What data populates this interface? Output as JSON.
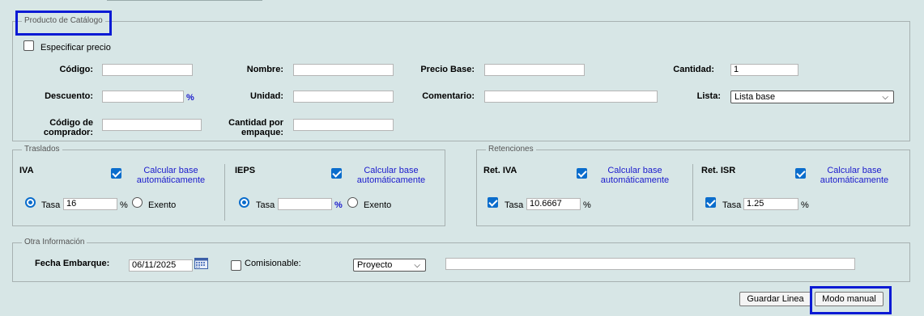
{
  "catalog": {
    "legend": "Producto de Catálogo",
    "especificar_precio": "Especificar precio",
    "codigo_label": "Código:",
    "codigo_value": "",
    "nombre_label": "Nombre:",
    "nombre_value": "",
    "precio_base_label": "Precio Base:",
    "precio_base_value": "",
    "cantidad_label": "Cantidad:",
    "cantidad_value": "1",
    "descuento_label": "Descuento:",
    "descuento_value": "",
    "percent": "%",
    "unidad_label": "Unidad:",
    "unidad_value": "",
    "comentario_label": "Comentario:",
    "comentario_value": "",
    "lista_label": "Lista:",
    "lista_value": "Lista base",
    "codigo_comprador_label_1": "Código de",
    "codigo_comprador_label_2": "comprador:",
    "codigo_comprador_value": "",
    "cantidad_empaque_label_1": "Cantidad por",
    "cantidad_empaque_label_2": "empaque:",
    "cantidad_empaque_value": ""
  },
  "traslados": {
    "legend": "Traslados",
    "iva": {
      "title": "IVA",
      "calc_line1": "Calcular base",
      "calc_line2": "automáticamente",
      "tasa_label": "Tasa",
      "tasa_value": "16",
      "percent": "%",
      "exento_label": "Exento"
    },
    "ieps": {
      "title": "IEPS",
      "calc_line1": "Calcular base",
      "calc_line2": "automáticamente",
      "tasa_label": "Tasa",
      "tasa_value": "",
      "percent": "%",
      "exento_label": "Exento"
    }
  },
  "retenciones": {
    "legend": "Retenciones",
    "ret_iva": {
      "title": "Ret. IVA",
      "calc_line1": "Calcular base",
      "calc_line2": "automáticamente",
      "tasa_label": "Tasa",
      "tasa_value": "10.6667",
      "percent": "%"
    },
    "ret_isr": {
      "title": "Ret. ISR",
      "calc_line1": "Calcular base",
      "calc_line2": "automáticamente",
      "tasa_label": "Tasa",
      "tasa_value": "1.25",
      "percent": "%"
    }
  },
  "otra": {
    "legend": "Otra Información",
    "fecha_label": "Fecha Embarque:",
    "fecha_value": "06/11/2025",
    "comisionable_label": "Comisionable:",
    "proyecto_value": "Proyecto",
    "extra_value": ""
  },
  "buttons": {
    "guardar": "Guardar Linea",
    "modo_manual": "Modo manual"
  },
  "colors": {
    "highlight": "#0a1ad4",
    "checkbox": "#0b6dcc",
    "link": "#1a1acc",
    "background": "#d7e6e6"
  }
}
